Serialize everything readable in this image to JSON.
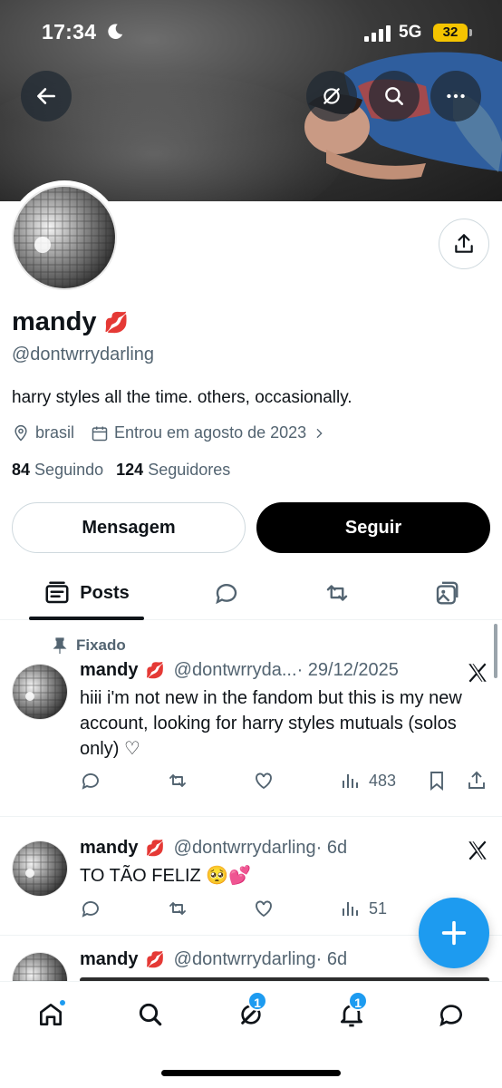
{
  "status_bar": {
    "time": "17:34",
    "network": "5G",
    "battery": "32"
  },
  "profile": {
    "name": "mandy",
    "name_emoji": "💋",
    "handle": "@dontwrrydarling",
    "bio": "harry styles all the time. others, occasionally.",
    "location": "brasil",
    "joined": "Entrou em agosto de 2023",
    "following_count": "84",
    "following_label": "Seguindo",
    "followers_count": "124",
    "followers_label": "Seguidores"
  },
  "buttons": {
    "message": "Mensagem",
    "follow": "Seguir"
  },
  "tabs": {
    "posts": "Posts"
  },
  "posts": [
    {
      "pinned_label": "Fixado",
      "name": "mandy",
      "emoji": "💋",
      "handle": "@dontwrryda...",
      "date": "· 29/12/2025",
      "text": "hiii i'm not new in the fandom but this is my new account, looking for harry styles mutuals (solos only) ♡",
      "views": "483"
    },
    {
      "name": "mandy",
      "emoji": "💋",
      "handle": "@dontwrrydarling",
      "date": "· 6d",
      "text": "TO TÃO FELIZ 🥺💕",
      "views": "51"
    },
    {
      "name": "mandy",
      "emoji": "💋",
      "handle": "@dontwrrydarling",
      "date": "· 6d"
    }
  ],
  "bottom_nav": {
    "grok_badge": "1",
    "notifications_badge": "1"
  },
  "colors": {
    "accent": "#1d9bf0",
    "text": "#0f1419",
    "secondary": "#536471",
    "border": "#cfd9de"
  },
  "icons": [
    "back-arrow-icon",
    "grok-icon",
    "search-icon",
    "more-icon",
    "share-icon",
    "location-icon",
    "calendar-icon",
    "chevron-right-icon",
    "posts-icon",
    "reply-icon",
    "repost-icon",
    "media-icon",
    "pin-icon",
    "x-logo-icon",
    "like-icon",
    "views-icon",
    "bookmark-icon",
    "plus-icon",
    "home-icon",
    "notifications-icon",
    "messages-icon"
  ]
}
